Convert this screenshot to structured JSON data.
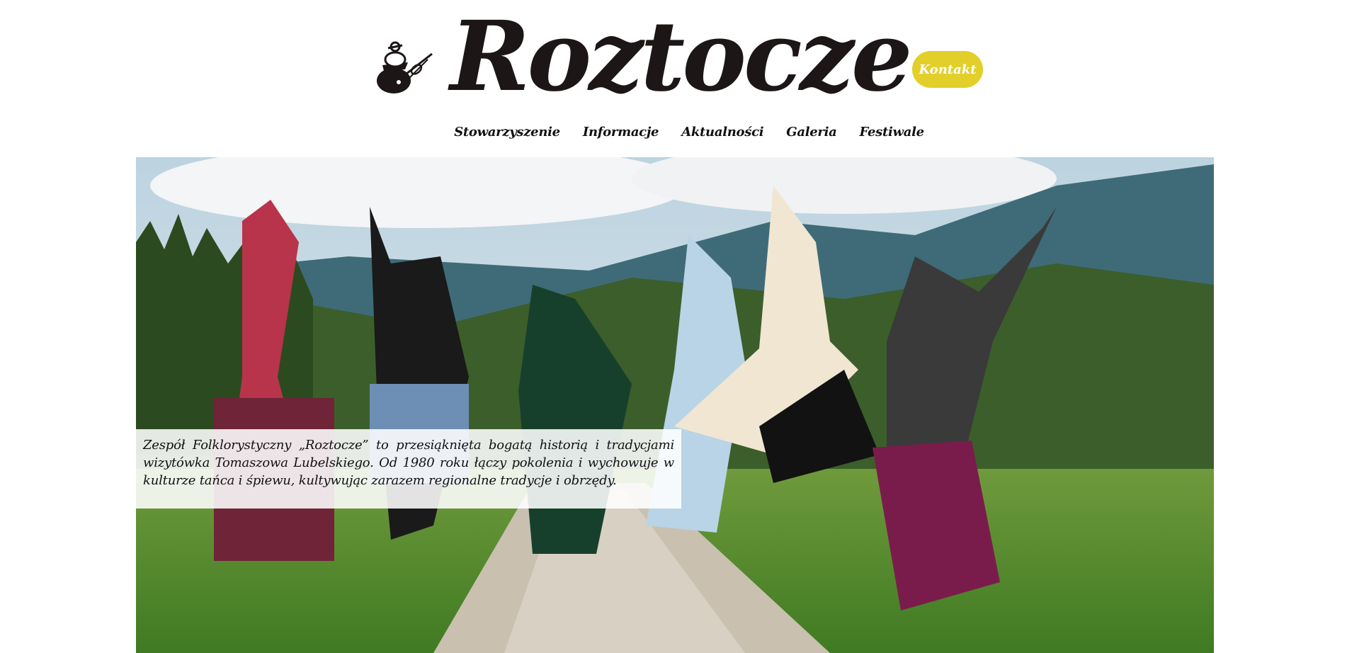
{
  "header": {
    "brand_title": "Roztocze",
    "contact_label": "Kontakt"
  },
  "nav": {
    "items": [
      {
        "label": "Stowarzyszenie"
      },
      {
        "label": "Informacje"
      },
      {
        "label": "Aktualności"
      },
      {
        "label": "Galeria"
      },
      {
        "label": "Festiwale"
      }
    ]
  },
  "hero": {
    "image": "group-of-dancers-in-folk-costumes-jumping-on-mountain-road-photo",
    "intro_text": "Zespół Folklorystyczny „Roztocze” to przesiąknięta bogatą historią i tradycjami wizytówka Tomaszowa Lubelskiego. Od 1980 roku łączy pokolenia i wychowuje w kulturze tańca i śpiewu, kultywując zarazem regionalne tradycje i obrzędy."
  },
  "colors": {
    "accent": "#e2cf2a",
    "text": "#111111",
    "background": "#ffffff"
  }
}
